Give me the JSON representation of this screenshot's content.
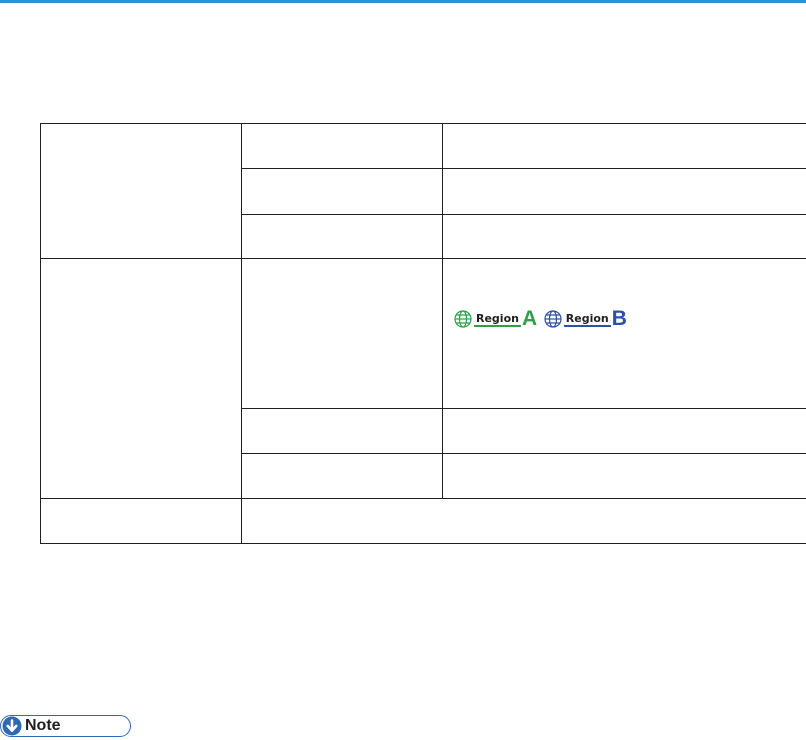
{
  "regions": {
    "a": {
      "word": "Region",
      "letter": "A",
      "color": "#2f9e48"
    },
    "b": {
      "word": "Region",
      "letter": "B",
      "color": "#2e4fa3"
    }
  },
  "note": {
    "label": "Note",
    "accent": "#2e6ab3"
  },
  "colors": {
    "top_rule": "#2e8fd3",
    "table_border": "#231f20"
  },
  "icons": [
    "globe-icon",
    "down-arrow-icon"
  ]
}
